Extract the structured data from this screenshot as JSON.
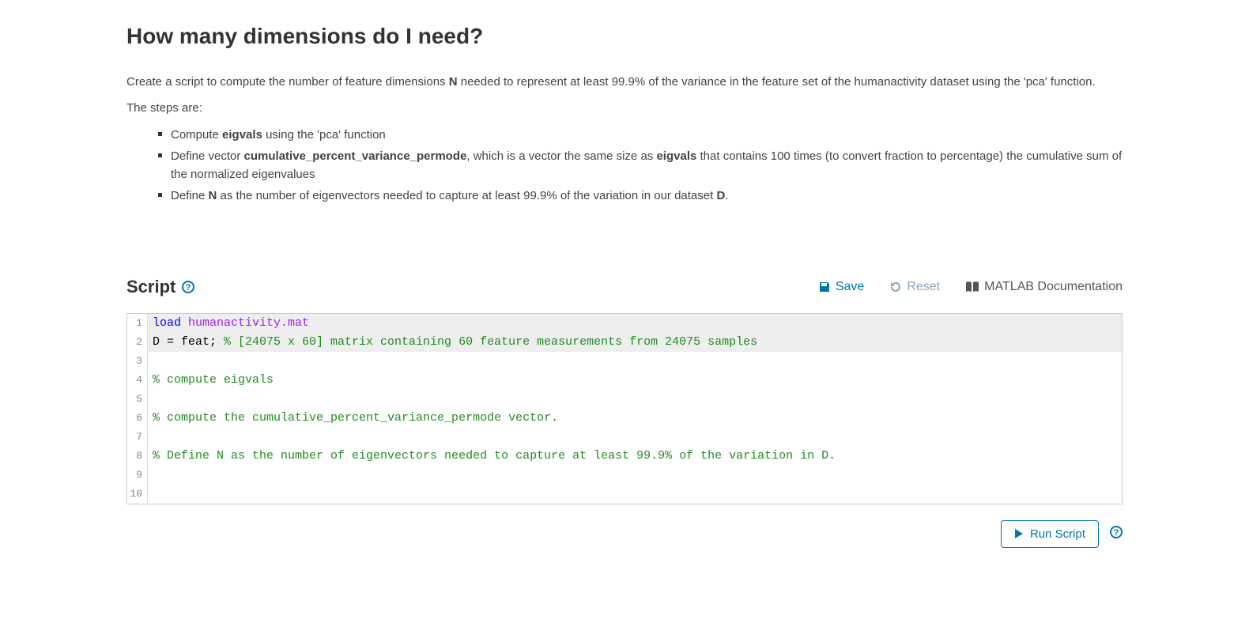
{
  "title": "How many dimensions do I need?",
  "intro_parts": [
    "Create a script to compute the number of feature dimensions ",
    "N",
    " needed to represent at least 99.9% of the variance in the feature set of the humanactivity dataset using the 'pca' function."
  ],
  "steps_label": "The steps are:",
  "steps": [
    {
      "parts": [
        "Compute ",
        "eigvals",
        " using the 'pca' function"
      ]
    },
    {
      "parts": [
        "Define vector ",
        "cumulative_percent_variance_permode",
        ", which is a vector the same size as ",
        "eigvals",
        " that contains 100 times (to convert fraction to percentage) the cumulative sum of the normalized eigenvalues"
      ]
    },
    {
      "parts": [
        "Define ",
        "N",
        " as the number of eigenvectors needed to capture at least 99.9% of the variation in our dataset ",
        "D",
        "."
      ]
    }
  ],
  "script_section_title": "Script",
  "toolbar": {
    "save": "Save",
    "reset": "Reset",
    "doc": "MATLAB Documentation"
  },
  "code_lines": [
    {
      "n": 1,
      "hl": true,
      "tokens": [
        {
          "t": "kw",
          "v": "load"
        },
        {
          "t": "id",
          "v": " "
        },
        {
          "t": "str",
          "v": "humanactivity.mat"
        }
      ]
    },
    {
      "n": 2,
      "hl": true,
      "tokens": [
        {
          "t": "id",
          "v": "D = feat; "
        },
        {
          "t": "com",
          "v": "% [24075 x 60] matrix containing 60 feature measurements from 24075 samples"
        }
      ]
    },
    {
      "n": 3,
      "hl": false,
      "tokens": [
        {
          "t": "id",
          "v": ""
        }
      ]
    },
    {
      "n": 4,
      "hl": false,
      "tokens": [
        {
          "t": "com",
          "v": "% compute eigvals"
        }
      ]
    },
    {
      "n": 5,
      "hl": false,
      "tokens": [
        {
          "t": "id",
          "v": ""
        }
      ]
    },
    {
      "n": 6,
      "hl": false,
      "tokens": [
        {
          "t": "com",
          "v": "% compute the cumulative_percent_variance_permode vector."
        }
      ]
    },
    {
      "n": 7,
      "hl": false,
      "tokens": [
        {
          "t": "id",
          "v": ""
        }
      ]
    },
    {
      "n": 8,
      "hl": false,
      "tokens": [
        {
          "t": "com",
          "v": "% Define N as the number of eigenvectors needed to capture at least 99.9% of the variation in D."
        }
      ]
    },
    {
      "n": 9,
      "hl": false,
      "tokens": [
        {
          "t": "id",
          "v": ""
        }
      ]
    },
    {
      "n": 10,
      "hl": false,
      "tokens": [
        {
          "t": "id",
          "v": ""
        }
      ]
    }
  ],
  "run_label": "Run Script"
}
